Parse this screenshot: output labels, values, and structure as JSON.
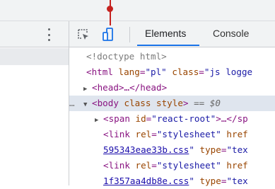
{
  "tabs": [
    {
      "label": "Elements",
      "active": true
    },
    {
      "label": "Console",
      "active": false
    }
  ],
  "icons": {
    "inspect": "inspect-element-icon",
    "device": "device-toolbar-icon",
    "menu": "more-vertical-icon"
  },
  "colors": {
    "pointer": "#c5221f",
    "tab_underline": "#1a73e8",
    "tag": "#881280",
    "attribute": "#994500",
    "value": "#1a1aa6"
  },
  "dom_lines": [
    {
      "text": "<!doctype html>"
    },
    {
      "tag_open": "<html ",
      "attr1": "lang",
      "eq1": "=",
      "val1": "\"pl\"",
      "attr2": " class",
      "eq2": "=",
      "val2": "\"js logge"
    },
    {
      "triangle": "▶",
      "text": "<head>…</head>"
    },
    {
      "prefix": "…",
      "triangle": "▼",
      "tag_open": "<body ",
      "attr": "class style",
      "tag_close": ">",
      "suffix": " == $0"
    },
    {
      "triangle": "▶",
      "tag_open": "<span ",
      "attr": "id",
      "eq": "=",
      "val": "\"react-root\"",
      "tag_close": ">…</sp"
    },
    {
      "tag_open": "<link ",
      "attr1": "rel",
      "eq1": "=",
      "val1": "\"stylesheet\"",
      "attr2": " href"
    },
    {
      "link": "595343eae33b.css",
      "quote_close": "\"",
      "attr": " type",
      "eq": "=",
      "val": "\"tex"
    },
    {
      "tag_open": "<link ",
      "attr1": "rel",
      "eq1": "=",
      "val1": "\"stylesheet\"",
      "attr2": " href"
    },
    {
      "link": "1f357aa4db8e.css",
      "quote_close": "\"",
      "attr": " type",
      "eq": "=",
      "val": "\"tex"
    }
  ]
}
